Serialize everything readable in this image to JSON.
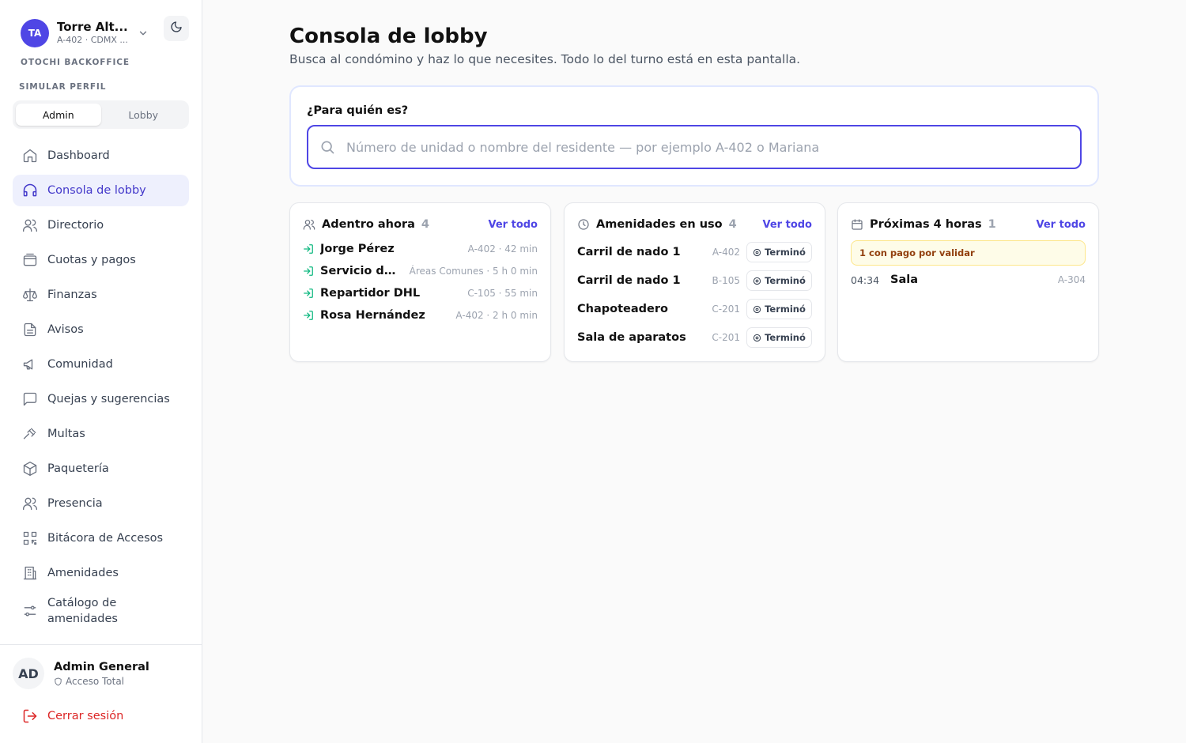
{
  "sidebar": {
    "org": {
      "initials": "TA",
      "name": "Torre Alt...",
      "subtitle": "A-402 · CDMX ..."
    },
    "brand": "OTOCHI BACKOFFICE",
    "simulate_label": "SIMULAR PERFIL",
    "profiles": [
      "Admin",
      "Lobby"
    ],
    "active_profile": "Admin",
    "nav": [
      {
        "label": "Dashboard",
        "icon": "home-icon"
      },
      {
        "label": "Consola de lobby",
        "icon": "headset-icon",
        "active": true
      },
      {
        "label": "Directorio",
        "icon": "users-icon"
      },
      {
        "label": "Cuotas y pagos",
        "icon": "wallet-icon"
      },
      {
        "label": "Finanzas",
        "icon": "scale-icon"
      },
      {
        "label": "Avisos",
        "icon": "file-text-icon"
      },
      {
        "label": "Comunidad",
        "icon": "megaphone-icon"
      },
      {
        "label": "Quejas y sugerencias",
        "icon": "message-square-icon"
      },
      {
        "label": "Multas",
        "icon": "gavel-icon"
      },
      {
        "label": "Paquetería",
        "icon": "package-icon"
      },
      {
        "label": "Presencia",
        "icon": "users-icon"
      },
      {
        "label": "Bitácora de Accesos",
        "icon": "qr-code-icon"
      },
      {
        "label": "Amenidades",
        "icon": "building-icon"
      },
      {
        "label": "Catálogo de amenidades",
        "icon": "sliders-icon"
      }
    ],
    "user": {
      "initials": "AD",
      "name": "Admin General",
      "role": "Acceso Total"
    },
    "logout_label": "Cerrar sesión"
  },
  "main": {
    "title": "Consola de lobby",
    "subtitle": "Busca al condómino y haz lo que necesites. Todo lo del turno está en esta pantalla.",
    "search": {
      "label": "¿Para quién es?",
      "placeholder": "Número de unidad o nombre del residente — por ejemplo A-402 o Mariana",
      "value": ""
    },
    "inside": {
      "title": "Adentro ahora",
      "count": "4",
      "link": "Ver todo",
      "items": [
        {
          "name": "Jorge Pérez",
          "meta": "A-402 · 42 min"
        },
        {
          "name": "Servicio de...",
          "meta": "Áreas Comunes · 5 h 0 min"
        },
        {
          "name": "Repartidor DHL",
          "meta": "C-105 · 55 min"
        },
        {
          "name": "Rosa Hernández",
          "meta": "A-402 · 2 h 0 min"
        }
      ]
    },
    "amenities": {
      "title": "Amenidades en uso",
      "count": "4",
      "link": "Ver todo",
      "items": [
        {
          "name": "Carril de nado 1",
          "unit": "A-402",
          "status": "Terminó"
        },
        {
          "name": "Carril de nado 1",
          "unit": "B-105",
          "status": "Terminó"
        },
        {
          "name": "Chapoteadero",
          "unit": "C-201",
          "status": "Terminó"
        },
        {
          "name": "Sala de aparatos",
          "unit": "C-201",
          "status": "Terminó"
        }
      ]
    },
    "upcoming": {
      "title": "Próximas 4 horas",
      "count": "1",
      "link": "Ver todo",
      "alert": "1 con pago por validar",
      "items": [
        {
          "time": "04:34",
          "name": "Sala",
          "unit": "A-304"
        }
      ]
    }
  },
  "colors": {
    "accent": "#4f46e5",
    "active_bg": "#eef0fd",
    "danger": "#dc2626",
    "entry_arrow": "#10b981"
  }
}
